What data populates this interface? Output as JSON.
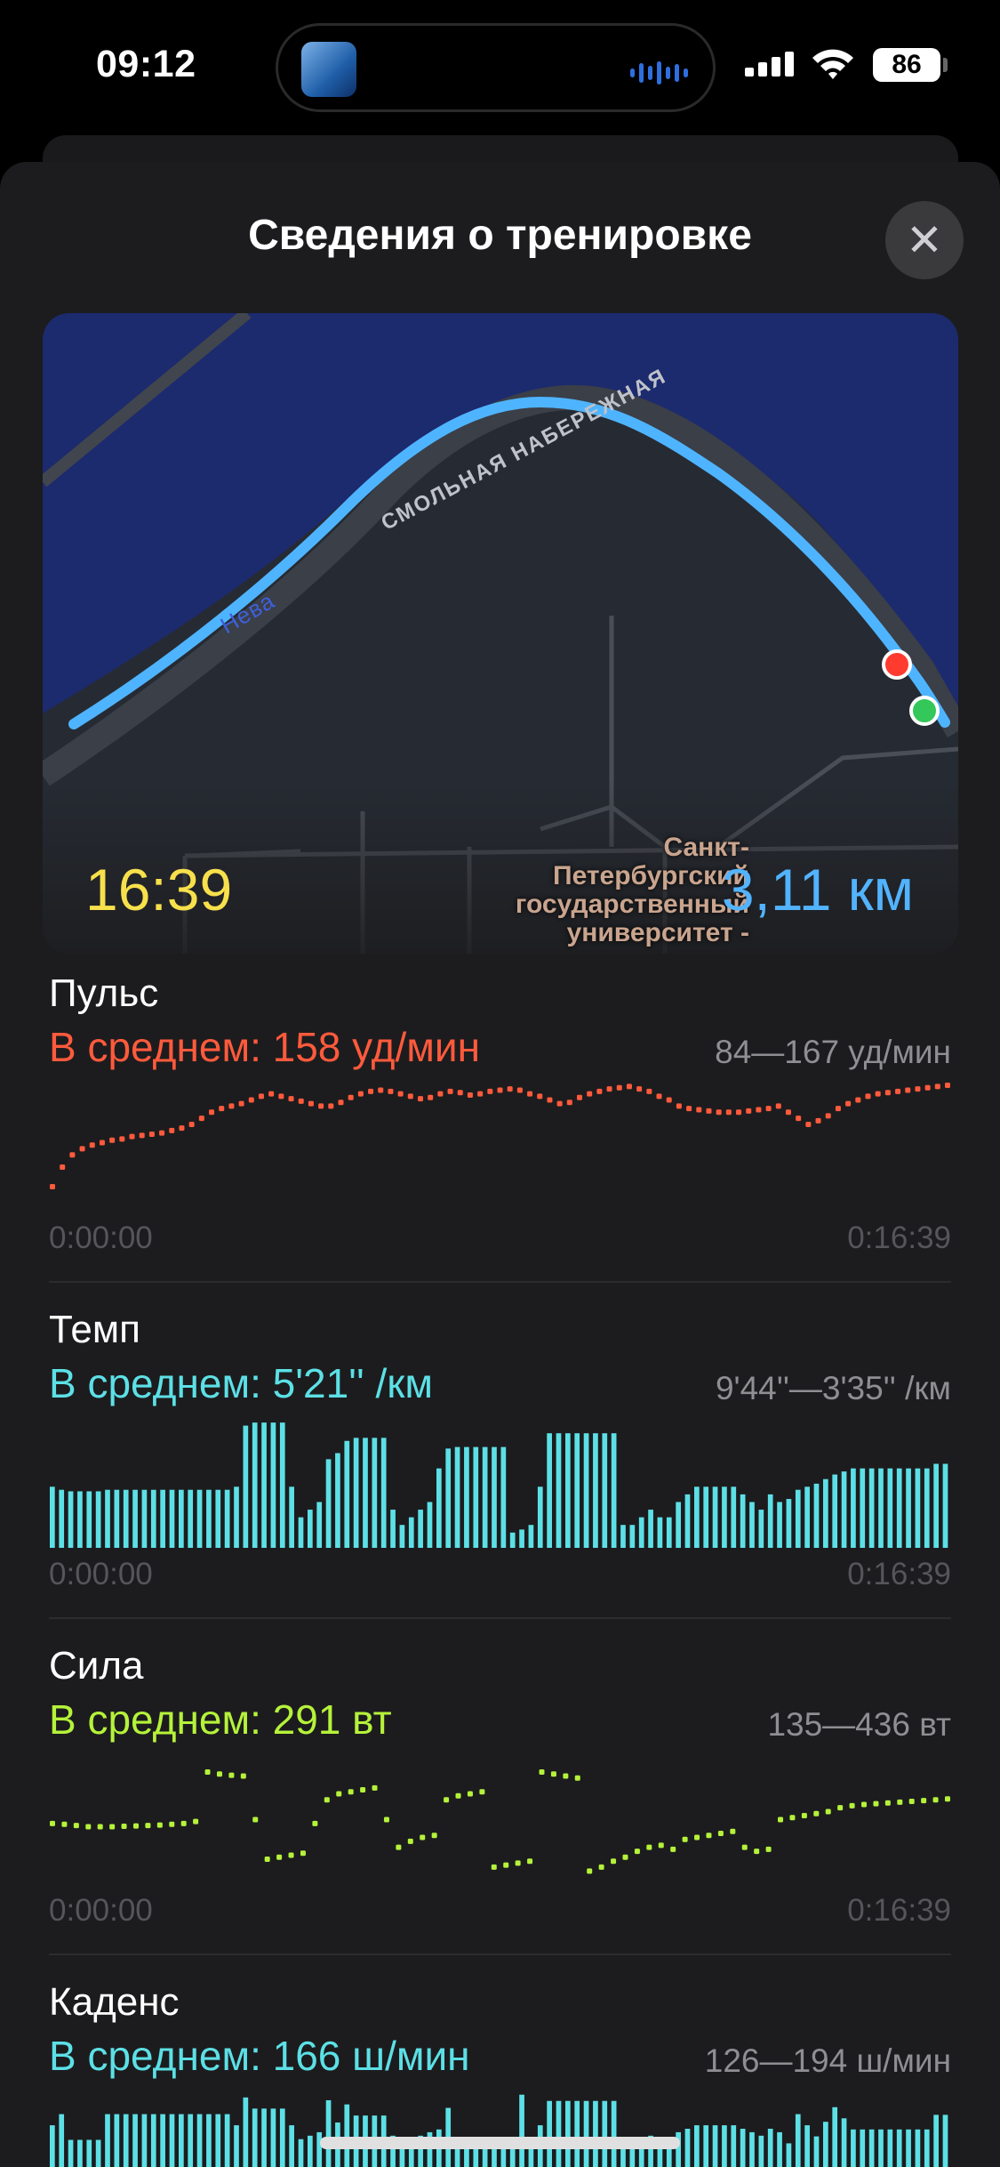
{
  "status": {
    "time": "09:12",
    "battery": "86"
  },
  "sheet": {
    "title": "Сведения о тренировке",
    "close_glyph": "✕"
  },
  "map": {
    "duration": "16:39",
    "distance": "3,11 км",
    "street": "СМОЛЬНАЯ НАБЕРЕЖНАЯ",
    "river": "Нева",
    "poi": "Санкт-\nПетербургский\nгосударственный\nуниверситет -",
    "start_color": "#34c759",
    "end_color": "#ff3b30",
    "route_color": "#4fb4ff"
  },
  "metrics": [
    {
      "name": "Пульс",
      "avg": "В среднем: 158 уд/мин",
      "range": "84—167 уд/мин",
      "start": "0:00:00",
      "end": "0:16:39",
      "color": "#ff5a3c"
    },
    {
      "name": "Темп",
      "avg": "В среднем: 5'21'' /км",
      "range": "9'44''—3'35'' /км",
      "start": "0:00:00",
      "end": "0:16:39",
      "color": "#5ce0e6"
    },
    {
      "name": "Сила",
      "avg": "В среднем: 291 вт",
      "range": "135—436 вт",
      "start": "0:00:00",
      "end": "0:16:39",
      "color": "#b5f23a"
    },
    {
      "name": "Каденс",
      "avg": "В среднем: 166 ш/мин",
      "range": "126—194 ш/мин",
      "color": "#5ce0e6"
    }
  ],
  "series": {
    "heart_rate": [
      84,
      100,
      110,
      115,
      118,
      120,
      122,
      123,
      125,
      126,
      127,
      128,
      130,
      132,
      135,
      140,
      145,
      148,
      150,
      152,
      155,
      158,
      160,
      158,
      156,
      154,
      152,
      150,
      150,
      153,
      157,
      160,
      162,
      163,
      162,
      160,
      158,
      156,
      157,
      160,
      162,
      161,
      159,
      160,
      162,
      163,
      164,
      163,
      160,
      158,
      155,
      152,
      153,
      157,
      160,
      162,
      164,
      165,
      166,
      164,
      162,
      158,
      155,
      150,
      148,
      147,
      146,
      145,
      145,
      145,
      146,
      147,
      148,
      150,
      145,
      140,
      135,
      138,
      142,
      148,
      152,
      155,
      158,
      160,
      161,
      162,
      163,
      164,
      165,
      166,
      167
    ],
    "pace": [
      40,
      38,
      37,
      37,
      37,
      37,
      38,
      38,
      38,
      38,
      38,
      38,
      38,
      38,
      38,
      38,
      38,
      38,
      38,
      38,
      40,
      80,
      82,
      82,
      82,
      82,
      40,
      20,
      25,
      30,
      58,
      62,
      70,
      72,
      72,
      72,
      72,
      25,
      15,
      20,
      25,
      30,
      52,
      65,
      66,
      66,
      66,
      66,
      66,
      66,
      10,
      12,
      15,
      40,
      75,
      75,
      75,
      75,
      75,
      75,
      75,
      75,
      15,
      15,
      20,
      25,
      20,
      20,
      30,
      35,
      40,
      40,
      40,
      40,
      40,
      35,
      30,
      25,
      35,
      30,
      32,
      38,
      40,
      42,
      45,
      48,
      50,
      52,
      52,
      52,
      52,
      52,
      52,
      52,
      52,
      52,
      55,
      55
    ],
    "power": [
      270,
      268,
      265,
      262,
      262,
      262,
      263,
      264,
      265,
      266,
      268,
      270,
      275,
      400,
      395,
      392,
      390,
      280,
      180,
      185,
      190,
      195,
      270,
      330,
      345,
      350,
      355,
      360,
      280,
      210,
      225,
      235,
      240,
      330,
      340,
      345,
      350,
      160,
      165,
      170,
      175,
      400,
      395,
      390,
      385,
      150,
      160,
      175,
      185,
      200,
      210,
      215,
      205,
      230,
      235,
      240,
      245,
      250,
      210,
      200,
      205,
      280,
      285,
      290,
      295,
      300,
      310,
      315,
      318,
      320,
      322,
      324,
      326,
      328,
      330,
      332
    ]
  }
}
